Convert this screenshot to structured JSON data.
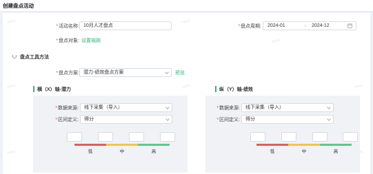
{
  "page": {
    "title": "创建盘点活动"
  },
  "form": {
    "activity_name_label": "活动名称:",
    "activity_name_value": "10月人才盘点",
    "period_label": "盘点周期:",
    "period_start": "2024-01",
    "period_sep": "→",
    "period_end": "2024-12",
    "target_label": "盘点对象:",
    "target_link": "设置规则"
  },
  "tool_section": {
    "title": "盘点工具方法",
    "plan_label": "盘点方案:",
    "plan_value": "潜力-绩效盘点方案",
    "preview_link": "预览"
  },
  "axes": [
    {
      "title": "横（X）轴-潜力",
      "source_label": "数据来源:",
      "source_value": "线下采集（导入）",
      "range_label": "区间定义:",
      "range_value": "得分",
      "levels": [
        "低",
        "中",
        "高"
      ]
    },
    {
      "title": "纵（Y）轴-绩效",
      "source_label": "数据来源:",
      "source_value": "线下采集（导入）",
      "range_label": "区间定义:",
      "range_value": "得分",
      "levels": [
        "低",
        "中",
        "高"
      ]
    }
  ],
  "colors": {
    "accent": "#2fb47a",
    "low": "#e25c5c",
    "mid": "#f5c542",
    "high": "#5cc98a",
    "required": "#e34d4d"
  },
  "icons": {
    "calendar": "calendar-icon",
    "dropdown": "chevron-down-icon",
    "section": "link-icon"
  }
}
